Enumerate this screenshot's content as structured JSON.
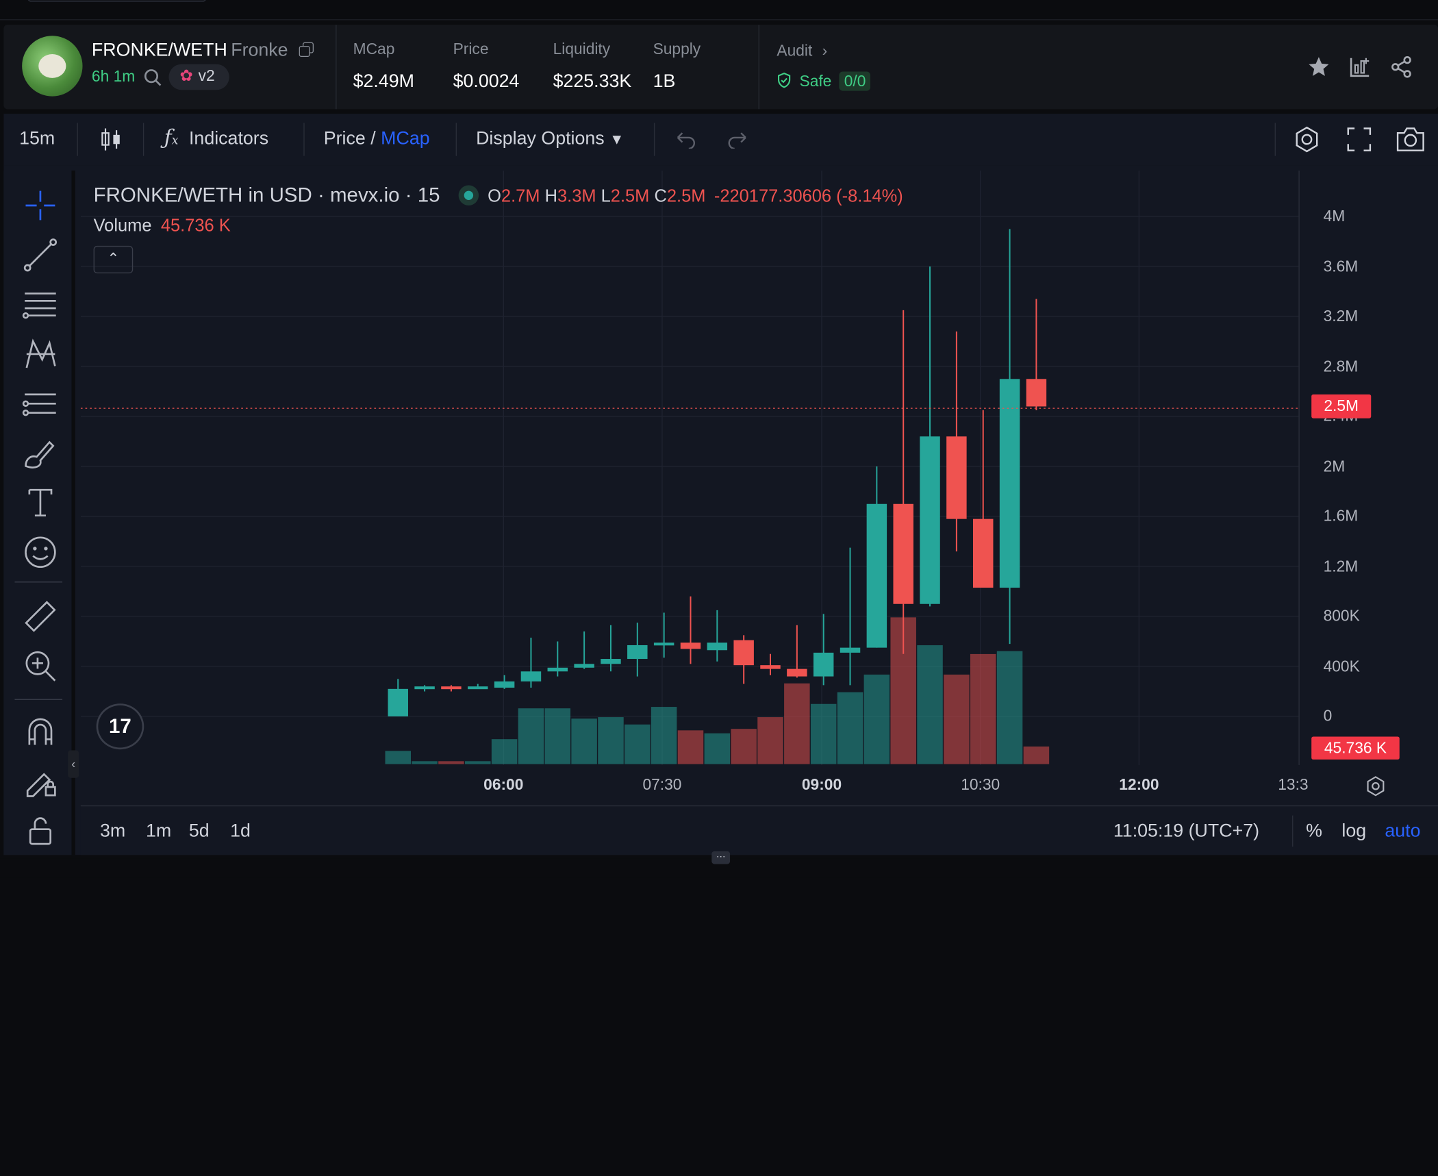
{
  "header": {
    "pair": "FRONKE/WETH",
    "token_name": "Fronke",
    "age": "6h 1m",
    "dex_version": "v2",
    "stats": [
      {
        "label": "MCap",
        "value": "$2.49M"
      },
      {
        "label": "Price",
        "value": "$0.0024"
      },
      {
        "label": "Liquidity",
        "value": "$225.33K"
      },
      {
        "label": "Supply",
        "value": "1B"
      }
    ],
    "audit_label": "Audit",
    "audit_status": "Safe",
    "audit_score": "0/0"
  },
  "toolbar": {
    "interval": "15m",
    "indicators": "Indicators",
    "price_label": "Price",
    "slash": "/",
    "mcap_label": "MCap",
    "display_options": "Display Options"
  },
  "chart": {
    "title": "FRONKE/WETH in USD · mevx.io · 15",
    "ohlc": {
      "o_key": "O",
      "o": "2.7M",
      "h_key": "H",
      "h": "3.3M",
      "l_key": "L",
      "l": "2.5M",
      "c_key": "C",
      "c": "2.5M",
      "change": "-220177.30606 (-8.14%)"
    },
    "volume_label": "Volume",
    "volume_value": "45.736 K",
    "last_price_label": "2.5M",
    "colors": {
      "up": "#26a69a",
      "down": "#ef5350",
      "accent": "#2962ff"
    }
  },
  "chart_data": {
    "type": "candlestick",
    "title": "FRONKE/WETH in USD · mevx.io · 15",
    "y_ticks": [
      "4M",
      "3.6M",
      "3.2M",
      "2.8M",
      "2.4M",
      "2M",
      "1.6M",
      "1.2M",
      "800K",
      "400K",
      "0"
    ],
    "x_ticks": [
      {
        "label": "06:00",
        "bold": true
      },
      {
        "label": "07:30",
        "bold": false
      },
      {
        "label": "09:00",
        "bold": true
      },
      {
        "label": "10:30",
        "bold": false
      },
      {
        "label": "12:00",
        "bold": true
      },
      {
        "label": "13:3",
        "bold": false
      }
    ],
    "ylim": [
      0,
      4000000
    ],
    "candles": [
      {
        "o": 0,
        "h": 300000,
        "l": 0,
        "c": 220000
      },
      {
        "o": 220000,
        "h": 250000,
        "l": 200000,
        "c": 240000
      },
      {
        "o": 240000,
        "h": 250000,
        "l": 200000,
        "c": 220000
      },
      {
        "o": 230000,
        "h": 260000,
        "l": 220000,
        "c": 240000
      },
      {
        "o": 230000,
        "h": 330000,
        "l": 220000,
        "c": 280000
      },
      {
        "o": 280000,
        "h": 630000,
        "l": 230000,
        "c": 360000
      },
      {
        "o": 360000,
        "h": 600000,
        "l": 320000,
        "c": 390000
      },
      {
        "o": 390000,
        "h": 680000,
        "l": 380000,
        "c": 420000
      },
      {
        "o": 420000,
        "h": 730000,
        "l": 360000,
        "c": 460000
      },
      {
        "o": 460000,
        "h": 750000,
        "l": 320000,
        "c": 570000
      },
      {
        "o": 570000,
        "h": 830000,
        "l": 470000,
        "c": 590000
      },
      {
        "o": 590000,
        "h": 960000,
        "l": 420000,
        "c": 540000
      },
      {
        "o": 530000,
        "h": 850000,
        "l": 440000,
        "c": 590000
      },
      {
        "o": 610000,
        "h": 650000,
        "l": 260000,
        "c": 410000
      },
      {
        "o": 410000,
        "h": 500000,
        "l": 330000,
        "c": 380000
      },
      {
        "o": 380000,
        "h": 730000,
        "l": 310000,
        "c": 320000
      },
      {
        "o": 320000,
        "h": 820000,
        "l": 250000,
        "c": 510000
      },
      {
        "o": 510000,
        "h": 1350000,
        "l": 250000,
        "c": 550000
      },
      {
        "o": 550000,
        "h": 2000000,
        "l": 550000,
        "c": 1700000
      },
      {
        "o": 1700000,
        "h": 3250000,
        "l": 500000,
        "c": 900000
      },
      {
        "o": 900000,
        "h": 3600000,
        "l": 880000,
        "c": 2240000
      },
      {
        "o": 2240000,
        "h": 3080000,
        "l": 1320000,
        "c": 1580000
      },
      {
        "o": 1580000,
        "h": 2450000,
        "l": 1030000,
        "c": 1030000
      },
      {
        "o": 1030000,
        "h": 3900000,
        "l": 580000,
        "c": 2700000
      },
      {
        "o": 2700000,
        "h": 3340000,
        "l": 2450000,
        "c": 2480000
      }
    ],
    "volume_relative": [
      0.09,
      0.02,
      0.02,
      0.02,
      0.17,
      0.38,
      0.38,
      0.31,
      0.32,
      0.27,
      0.39,
      0.23,
      0.21,
      0.24,
      0.32,
      0.55,
      0.41,
      0.49,
      0.61,
      1.0,
      0.81,
      0.61,
      0.75,
      0.77,
      0.12
    ]
  },
  "bottom_bar": {
    "ranges": [
      "3m",
      "1m",
      "5d",
      "1d"
    ],
    "clock": "11:05:19 (UTC+7)",
    "percent": "%",
    "log": "log",
    "auto": "auto"
  }
}
